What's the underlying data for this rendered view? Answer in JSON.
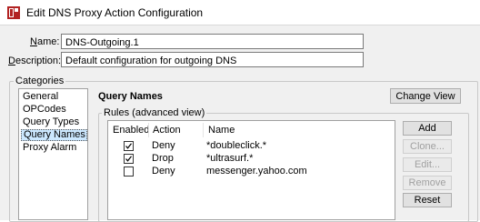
{
  "window": {
    "title": "Edit DNS Proxy Action Configuration",
    "icon": "firebox-app-icon"
  },
  "form": {
    "name_label_first": "N",
    "name_label_rest": "ame:",
    "name_value": "DNS-Outgoing.1",
    "description_label_first": "D",
    "description_label_rest": "escription:",
    "description_value": "Default configuration for outgoing DNS"
  },
  "categories": {
    "group_label": "Categories",
    "items": [
      {
        "label": "General",
        "selected": false
      },
      {
        "label": "OPCodes",
        "selected": false
      },
      {
        "label": "Query Types",
        "selected": false
      },
      {
        "label": "Query Names",
        "selected": true
      },
      {
        "label": "Proxy Alarm",
        "selected": false
      }
    ]
  },
  "panel": {
    "title": "Query Names",
    "change_view_label": "Change View",
    "rules_group_label": "Rules (advanced view)"
  },
  "rules_table": {
    "columns": [
      "Enabled",
      "Action",
      "Name"
    ],
    "rows": [
      {
        "enabled": true,
        "action": "Deny",
        "name": "*doubleclick.*"
      },
      {
        "enabled": true,
        "action": "Drop",
        "name": "*ultrasurf.*"
      },
      {
        "enabled": false,
        "action": "Deny",
        "name": "messenger.yahoo.com"
      }
    ]
  },
  "rule_buttons": {
    "add": {
      "label": "Add",
      "enabled": true
    },
    "clone": {
      "label": "Clone...",
      "enabled": false
    },
    "edit": {
      "label": "Edit...",
      "enabled": false
    },
    "remove": {
      "label": "Remove",
      "enabled": false
    },
    "reset": {
      "label": "Reset",
      "enabled": true
    }
  },
  "colors": {
    "selection": "#cce8ff",
    "window_bg": "#f0f0f0",
    "button_bg": "#e1e1e1",
    "disabled_text": "#a0a0a0"
  }
}
